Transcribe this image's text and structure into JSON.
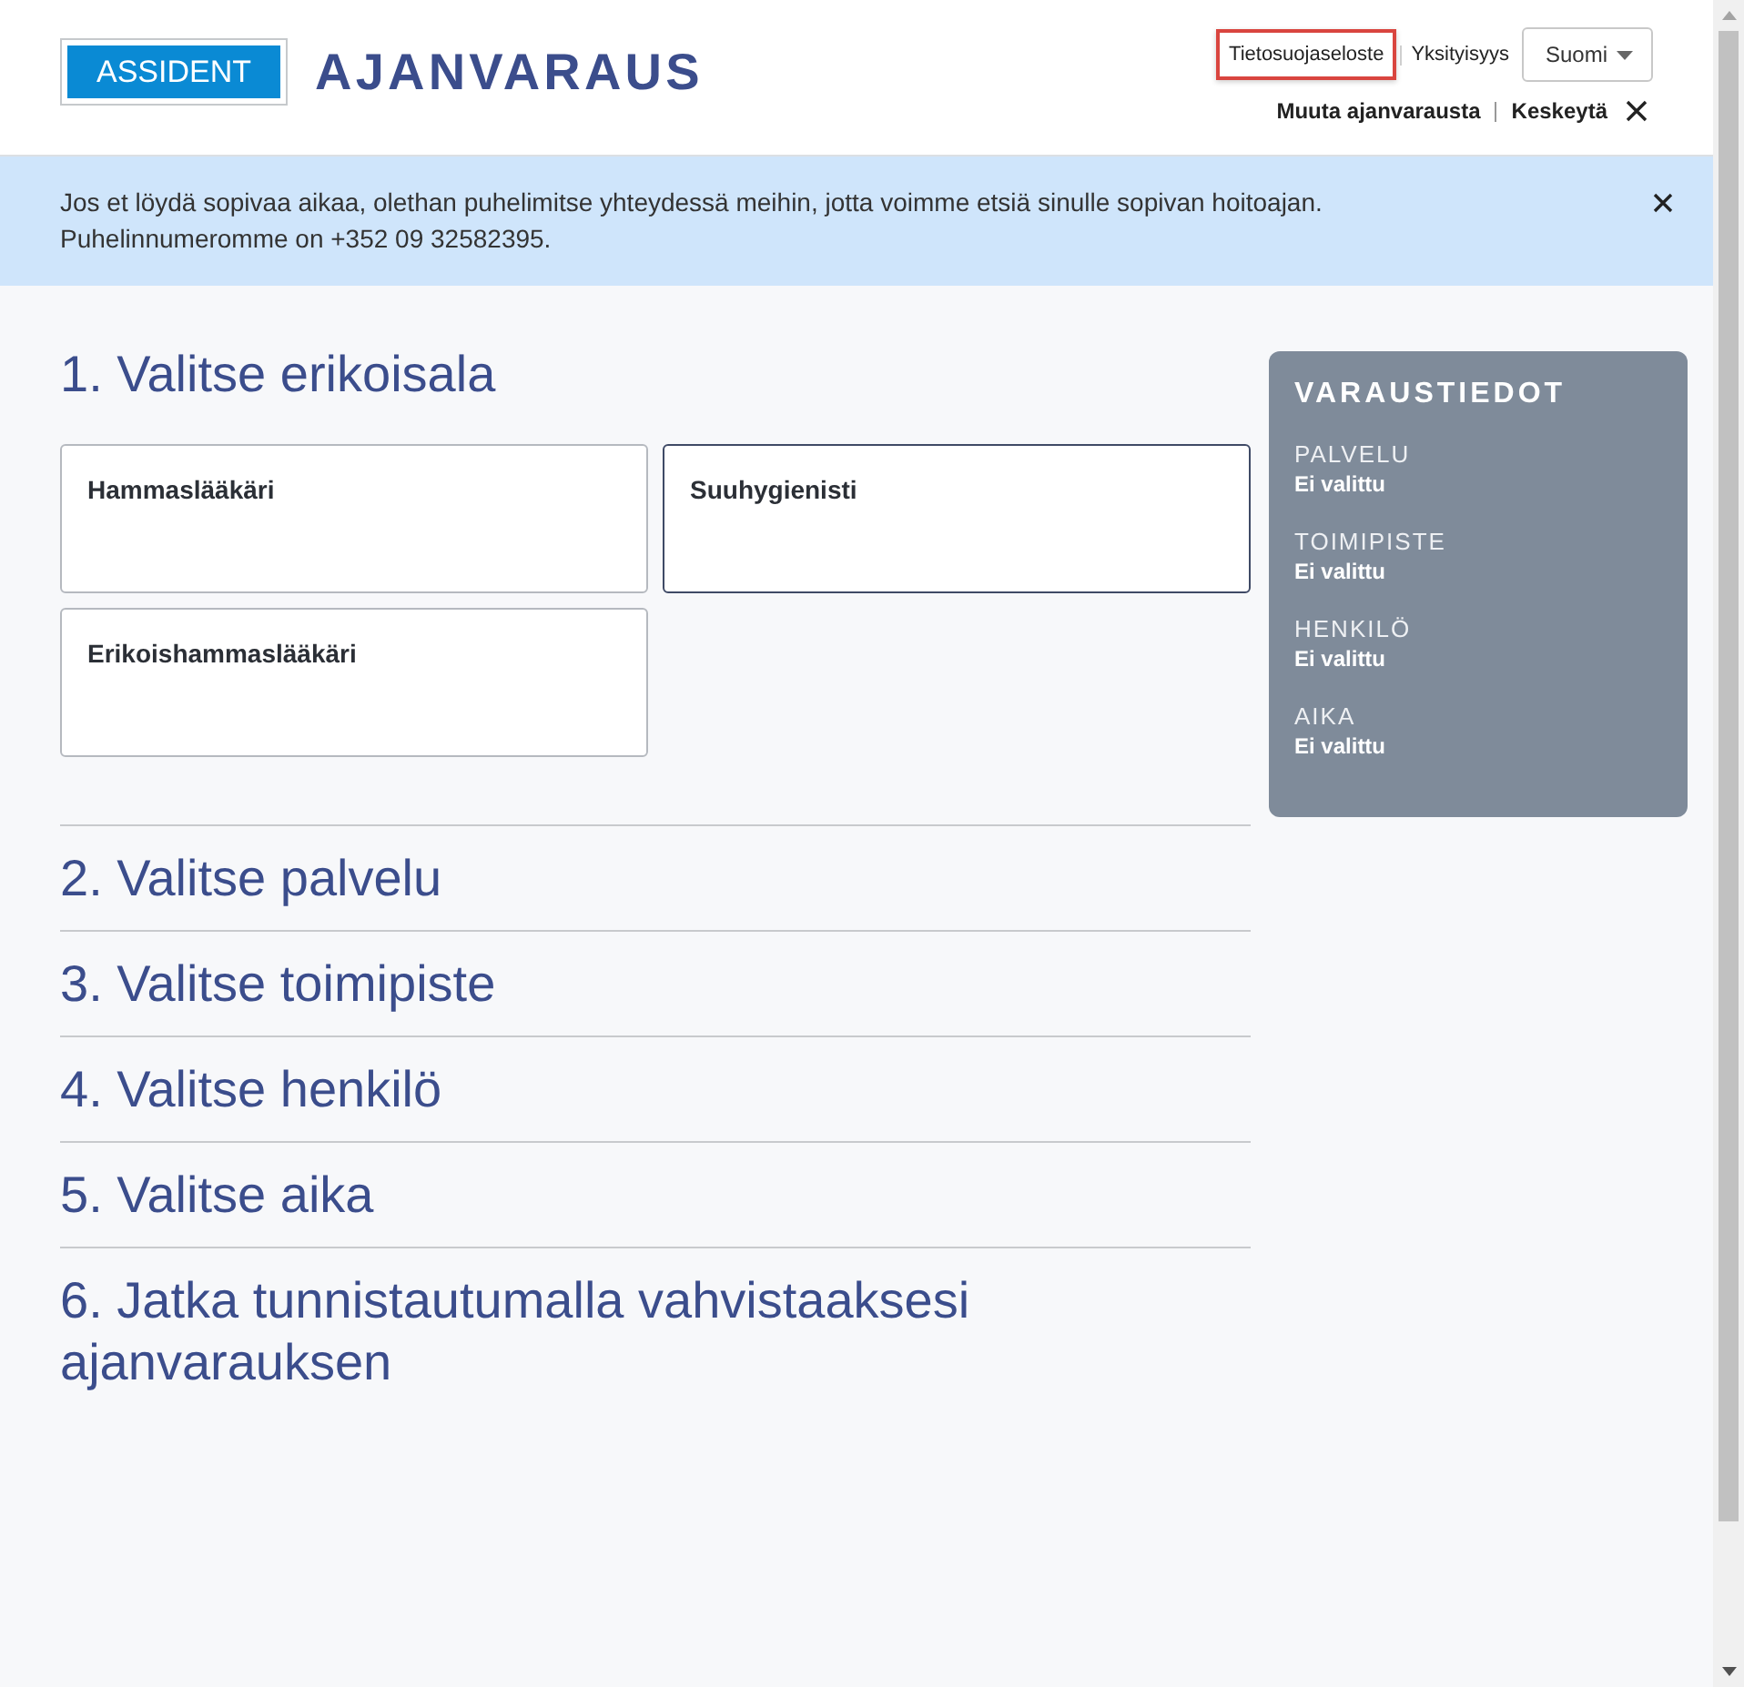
{
  "header": {
    "logo": "ASSIDENT",
    "title": "AJANVARAUS",
    "links": [
      {
        "label": "Tietosuojaseloste",
        "highlighted": true
      },
      {
        "label": "Yksityisyys",
        "highlighted": false
      }
    ],
    "language_select": {
      "value": "Suomi"
    },
    "actions": [
      {
        "label": "Muuta ajanvarausta",
        "kind": "link"
      },
      {
        "label": "Keskeytä",
        "kind": "cancel"
      }
    ]
  },
  "notice": {
    "text": "Jos et löydä sopivaa aikaa, olethan puhelimitse yhteydessä meihin, jotta voimme etsiä sinulle sopivan hoitoajan.\nPuhelinnumeromme on +352 09 32582395."
  },
  "steps": [
    {
      "title": "1. Valitse erikoisala",
      "options": [
        {
          "label": "Hammaslääkäri",
          "selected": false
        },
        {
          "label": "Suuhygienisti",
          "selected": true
        },
        {
          "label": "Erikoishammaslääkäri",
          "selected": false
        }
      ]
    },
    {
      "title": "2. Valitse palvelu"
    },
    {
      "title": "3. Valitse toimipiste"
    },
    {
      "title": "4. Valitse henkilö"
    },
    {
      "title": "5. Valitse aika"
    },
    {
      "title": "6. Jatka tunnistautumalla vahvistaaksesi ajanvarauksen"
    }
  ],
  "summary": {
    "title": "VARAUSTIEDOT",
    "fields": [
      {
        "label": "PALVELU",
        "value": "Ei valittu"
      },
      {
        "label": "TOIMIPISTE",
        "value": "Ei valittu"
      },
      {
        "label": "HENKILÖ",
        "value": "Ei valittu"
      },
      {
        "label": "AIKA",
        "value": "Ei valittu"
      }
    ]
  }
}
